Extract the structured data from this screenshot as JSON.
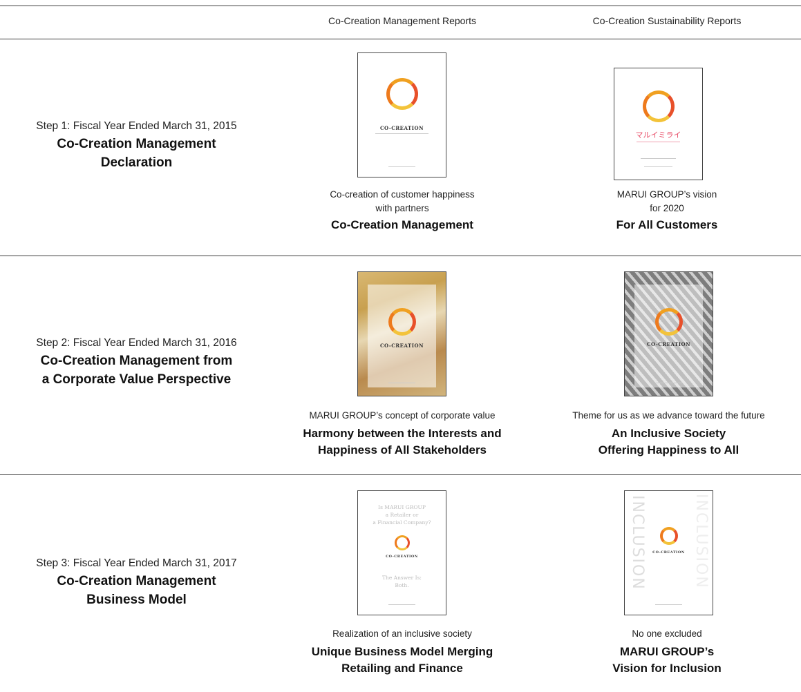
{
  "columns": {
    "management": "Co-Creation Management Reports",
    "sustainability": "Co-Creation Sustainability Reports"
  },
  "rows": [
    {
      "step_sub": "Step 1: Fiscal Year Ended March 31, 2015",
      "step_main_lines": [
        "Co-Creation Management",
        "Declaration"
      ],
      "management_cover": {
        "title": "CO-CREATION"
      },
      "management_caption_lines": [
        "Co-creation of customer happiness",
        "with partners"
      ],
      "management_bold_lines": [
        "Co-Creation Management"
      ],
      "sustainability_cover": {
        "title": "マルイミライ"
      },
      "sustainability_caption_lines": [
        "MARUI GROUP’s vision",
        "for 2020"
      ],
      "sustainability_bold_lines": [
        "For All Customers"
      ]
    },
    {
      "step_sub": "Step 2: Fiscal Year Ended March 31, 2016",
      "step_main_lines": [
        "Co-Creation Management from",
        "a Corporate Value Perspective"
      ],
      "management_cover": {
        "title": "CO-CREATION"
      },
      "management_caption_lines": [
        "MARUI GROUP’s concept of corporate value"
      ],
      "management_bold_lines": [
        "Harmony between the Interests and",
        "Happiness of All Stakeholders"
      ],
      "sustainability_cover": {
        "title": "CO-CREATION"
      },
      "sustainability_caption_lines": [
        "Theme for us as we advance toward the future"
      ],
      "sustainability_bold_lines": [
        "An Inclusive Society",
        "Offering Happiness to All"
      ]
    },
    {
      "step_sub": "Step 3: Fiscal Year Ended March 31, 2017",
      "step_main_lines": [
        "Co-Creation Management",
        "Business Model"
      ],
      "management_cover": {
        "title": "CO-CREATION",
        "lines": [
          "Is MARUI GROUP",
          "a Retailer or",
          "a Financial Company?"
        ],
        "answer_lines": [
          "The Answer Is:",
          "Both."
        ]
      },
      "management_caption_lines": [
        "Realization of an inclusive society"
      ],
      "management_bold_lines": [
        "Unique Business Model Merging",
        "Retailing and Finance"
      ],
      "sustainability_cover": {
        "title": "CO-CREATION",
        "vertical": "INCLUSION"
      },
      "sustainability_caption_lines": [
        "No one excluded"
      ],
      "sustainability_bold_lines": [
        "MARUI GROUP’s",
        "Vision for Inclusion"
      ]
    }
  ],
  "colors": {
    "rule": "#3a3a3a",
    "ring_orange": "#ee7a1c",
    "ring_red": "#e8502a",
    "ring_yellow": "#f3c33a"
  }
}
